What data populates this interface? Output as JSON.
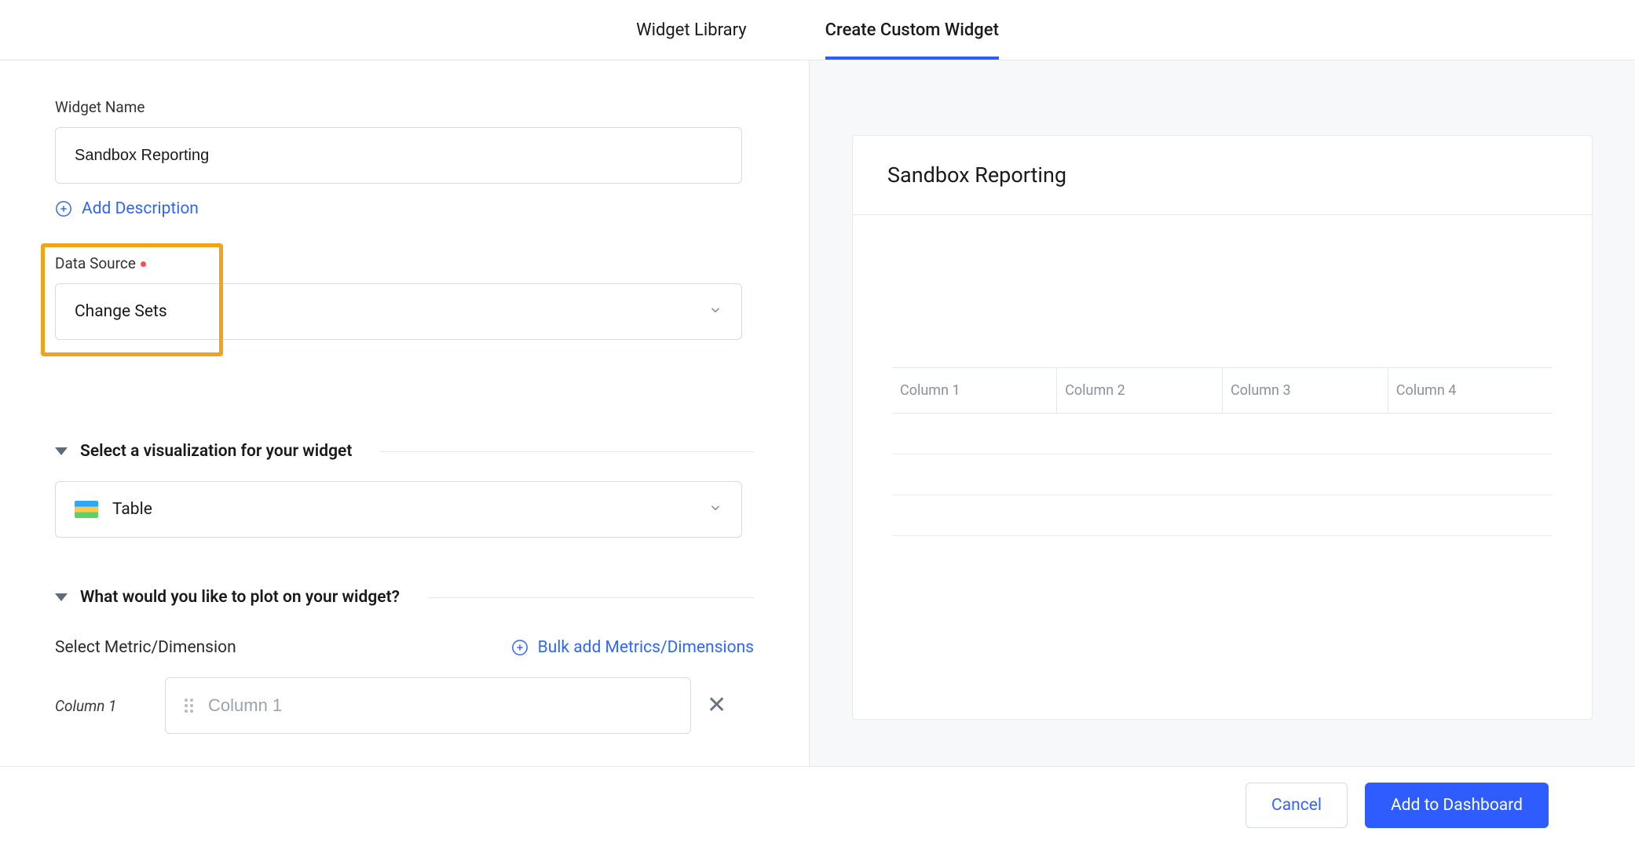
{
  "tabs": {
    "library": "Widget Library",
    "create": "Create Custom Widget"
  },
  "form": {
    "widget_name_label": "Widget Name",
    "widget_name_value": "Sandbox Reporting",
    "add_description": "Add Description",
    "data_source_label": "Data Source",
    "data_source_value": "Change Sets",
    "visualization_section_title": "Select a visualization for your widget",
    "visualization_value": "Table",
    "plot_section_title": "What would you like to plot on your widget?",
    "select_metric_label": "Select Metric/Dimension",
    "bulk_add_label": "Bulk add Metrics/Dimensions",
    "column_label": "Column 1",
    "column_placeholder": "Column 1"
  },
  "preview": {
    "title": "Sandbox Reporting",
    "columns": [
      "Column 1",
      "Column 2",
      "Column 3",
      "Column 4"
    ]
  },
  "footer": {
    "cancel": "Cancel",
    "add": "Add to Dashboard"
  }
}
